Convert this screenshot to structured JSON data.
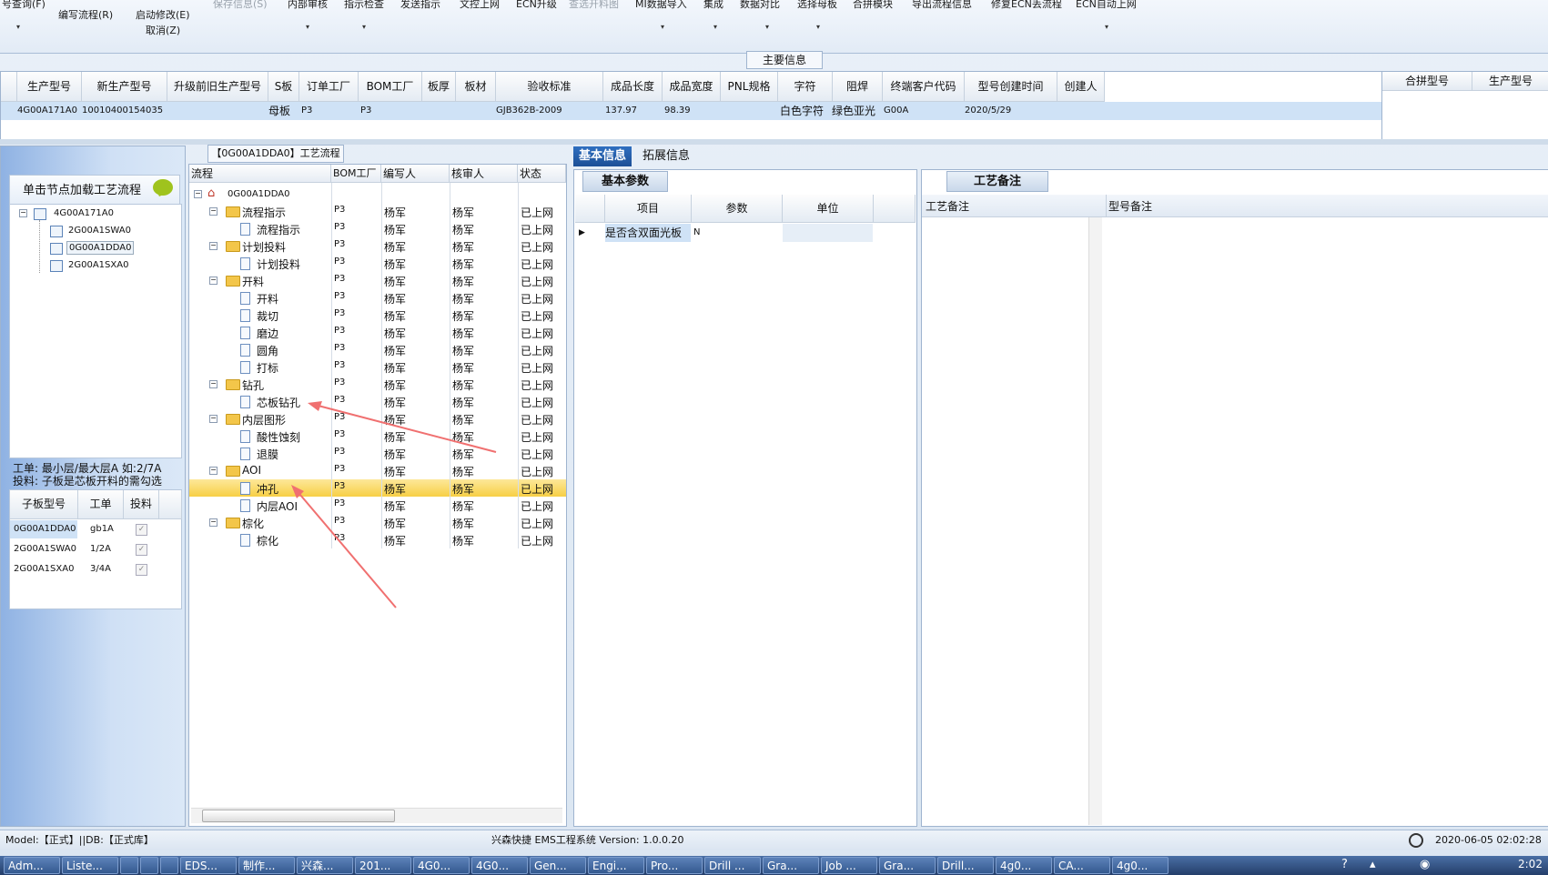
{
  "ribbon": {
    "items": [
      {
        "label": "号查询(F)",
        "disabled": false
      },
      {
        "label": "编写流程(R)",
        "disabled": false
      },
      {
        "label": "启动修改(E)",
        "disabled": false
      },
      {
        "label": "取消(Z)",
        "disabled": false
      },
      {
        "label": "保存信息(S)",
        "disabled": true
      },
      {
        "label": "内部审核",
        "disabled": false
      },
      {
        "label": "指示检查",
        "disabled": false
      },
      {
        "label": "发送指示",
        "disabled": false
      },
      {
        "label": "文控上网",
        "disabled": false
      },
      {
        "label": "ECN升级",
        "disabled": false
      },
      {
        "label": "查选开料图",
        "disabled": true
      },
      {
        "label": "MI数据导入",
        "disabled": false
      },
      {
        "label": "集成",
        "disabled": false
      },
      {
        "label": "数据对比",
        "disabled": false
      },
      {
        "label": "选择母板",
        "disabled": false
      },
      {
        "label": "合拼模块",
        "disabled": false
      },
      {
        "label": "导出流程信息",
        "disabled": false
      },
      {
        "label": "修复ECN丢流程",
        "disabled": false
      },
      {
        "label": "ECN自动上网",
        "disabled": false
      }
    ],
    "dropdown_glyph": "▾"
  },
  "main_info": {
    "title": "主要信息",
    "columns": [
      "生产型号",
      "新生产型号",
      "升级前旧生产型号",
      "S板",
      "订单工厂",
      "BOM工厂",
      "板厚",
      "板材",
      "验收标准",
      "成品长度",
      "成品宽度",
      "PNL规格",
      "字符",
      "阻焊",
      "终端客户代码",
      "型号创建时间",
      "创建人"
    ],
    "row": [
      "4G00A171A0",
      "10010400154035",
      "",
      "母板",
      "P3",
      "P3",
      "",
      "",
      "GJB362B-2009",
      "137.97",
      "98.39",
      "",
      "白色字符",
      "绿色亚光",
      "G00A",
      "2020/5/29",
      ""
    ],
    "merge_columns": [
      "合拼型号",
      "生产型号"
    ]
  },
  "left_panel": {
    "tip": "单击节点加载工艺流程",
    "tree": {
      "root": "4G00A171A0",
      "children": [
        "2G00A1SWA0",
        "0G00A1DDA0",
        "2G00A1SXA0"
      ],
      "selected": "0G00A1DDA0"
    },
    "hint_line1": "工单: 最小层/最大层A 如:2/7A",
    "hint_line2": "投料: 子板是芯板开料的需勾选",
    "sub_grid": {
      "columns": [
        "子板型号",
        "工单",
        "投料"
      ],
      "rows": [
        {
          "model": "0G00A1DDA0",
          "order": "gb1A",
          "feed": true
        },
        {
          "model": "2G00A1SWA0",
          "order": "1/2A",
          "feed": true
        },
        {
          "model": "2G00A1SXA0",
          "order": "3/4A",
          "feed": true
        }
      ]
    }
  },
  "process": {
    "title": "【0G00A1DDA0】工艺流程",
    "columns": [
      "流程",
      "BOM工厂",
      "编写人",
      "核审人",
      "状态"
    ],
    "root": "0G00A1DDA0",
    "rows": [
      {
        "name": "流程指示",
        "level": 1,
        "type": "folder"
      },
      {
        "name": "流程指示",
        "level": 2,
        "type": "doc"
      },
      {
        "name": "计划投料",
        "level": 1,
        "type": "folder"
      },
      {
        "name": "计划投料",
        "level": 2,
        "type": "doc"
      },
      {
        "name": "开料",
        "level": 1,
        "type": "folder"
      },
      {
        "name": "开料",
        "level": 2,
        "type": "doc"
      },
      {
        "name": "裁切",
        "level": 2,
        "type": "doc"
      },
      {
        "name": "磨边",
        "level": 2,
        "type": "doc"
      },
      {
        "name": "圆角",
        "level": 2,
        "type": "doc"
      },
      {
        "name": "打标",
        "level": 2,
        "type": "doc"
      },
      {
        "name": "钻孔",
        "level": 1,
        "type": "folder"
      },
      {
        "name": "芯板钻孔",
        "level": 2,
        "type": "doc"
      },
      {
        "name": "内层图形",
        "level": 1,
        "type": "folder"
      },
      {
        "name": "酸性蚀刻",
        "level": 2,
        "type": "doc"
      },
      {
        "name": "退膜",
        "level": 2,
        "type": "doc"
      },
      {
        "name": "AOI",
        "level": 1,
        "type": "folder"
      },
      {
        "name": "冲孔",
        "level": 2,
        "type": "doc",
        "selected": true
      },
      {
        "name": "内层AOI",
        "level": 2,
        "type": "doc"
      },
      {
        "name": "棕化",
        "level": 1,
        "type": "folder"
      },
      {
        "name": "棕化",
        "level": 2,
        "type": "doc"
      }
    ],
    "bom": "P3",
    "writer": "杨军",
    "reviewer": "杨军",
    "status": "已上网"
  },
  "right": {
    "tabs": [
      "基本信息",
      "拓展信息"
    ],
    "basic_title": "基本参数",
    "basic_columns": [
      "项目",
      "参数",
      "单位"
    ],
    "basic_row": {
      "item": "是否含双面光板",
      "param": "N",
      "unit": ""
    },
    "craft_title": "工艺备注",
    "craft_columns": [
      "工艺备注",
      "型号备注"
    ]
  },
  "status": {
    "left": "Model:【正式】||DB:【正式库】",
    "center": "兴森快捷 EMS工程系统 Version: 1.0.0.20",
    "datetime": "2020-06-05 02:02:28"
  },
  "taskbar": {
    "items": [
      "Adm...",
      "Liste...",
      "",
      "",
      "",
      "EDS...",
      "制作...",
      "兴森...",
      "201...",
      "4G0...",
      "4G0...",
      "Gen...",
      "Engi...",
      "Pro...",
      "Drill ...",
      "Gra...",
      "Job ...",
      "Gra...",
      "Drill...",
      "4g0...",
      "CA...",
      "4g0..."
    ],
    "clock": "2:02"
  },
  "colors": {
    "accent": "#1c4f96",
    "selected_row": "#f7cf45",
    "header_row": "#cfe2f6",
    "arrow": "#f07070"
  }
}
